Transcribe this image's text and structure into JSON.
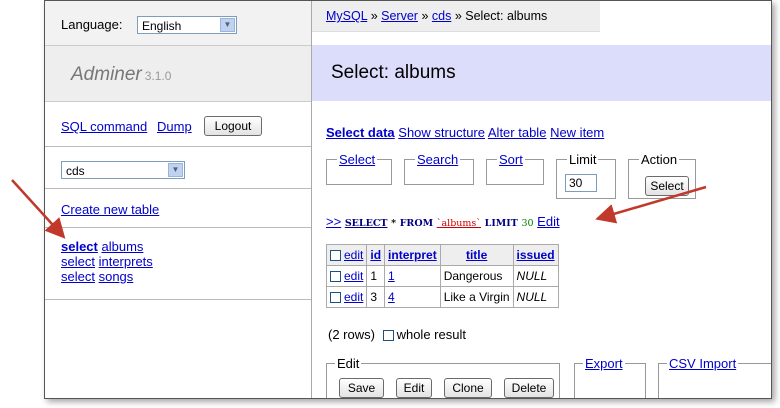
{
  "sidebar": {
    "language_label": "Language:",
    "language_value": "English",
    "app_name": "Adminer",
    "app_version": "3.1.0",
    "sql_command": "SQL command",
    "dump": "Dump",
    "logout": "Logout",
    "database_value": "cds",
    "create_table": "Create new table",
    "tables": [
      {
        "action": "select",
        "name": "albums"
      },
      {
        "action": "select",
        "name": "interprets"
      },
      {
        "action": "select",
        "name": "songs"
      }
    ]
  },
  "breadcrumb": {
    "mysql": "MySQL",
    "sep": "»",
    "server": "Server",
    "db": "cds",
    "current": "Select: albums"
  },
  "page": {
    "title": "Select: albums",
    "links": {
      "select_data": "Select data",
      "show_structure": "Show structure",
      "alter_table": "Alter table",
      "new_item": "New item"
    },
    "filters": {
      "select": "Select",
      "search": "Search",
      "sort": "Sort",
      "limit_legend": "Limit",
      "limit_value": "30",
      "action_legend": "Action",
      "action_button": "Select"
    },
    "query": {
      "prefix": ">>",
      "kw_select": "SELECT",
      "star": "*",
      "kw_from": "FROM",
      "table": "`albums`",
      "kw_limit": "LIMIT",
      "limit": "30",
      "edit": "Edit"
    },
    "table": {
      "headers": [
        "edit",
        "id",
        "interpret",
        "title",
        "issued"
      ],
      "rows": [
        {
          "edit": "edit",
          "id": "1",
          "interpret": "1",
          "title": "Dangerous",
          "issued": "NULL"
        },
        {
          "edit": "edit",
          "id": "3",
          "interpret": "4",
          "title": "Like a Virgin",
          "issued": "NULL"
        }
      ]
    },
    "row_count": "(2 rows)",
    "whole_result": "whole result",
    "edit_section": {
      "legend": "Edit",
      "save": "Save",
      "edit": "Edit",
      "clone": "Clone",
      "delete": "Delete"
    },
    "export": "Export",
    "csv_import": "CSV Import"
  },
  "colors": {
    "link": "#0000cc",
    "title_bg": "#dcdcfb",
    "annotation_arrow": "#c0392b"
  }
}
